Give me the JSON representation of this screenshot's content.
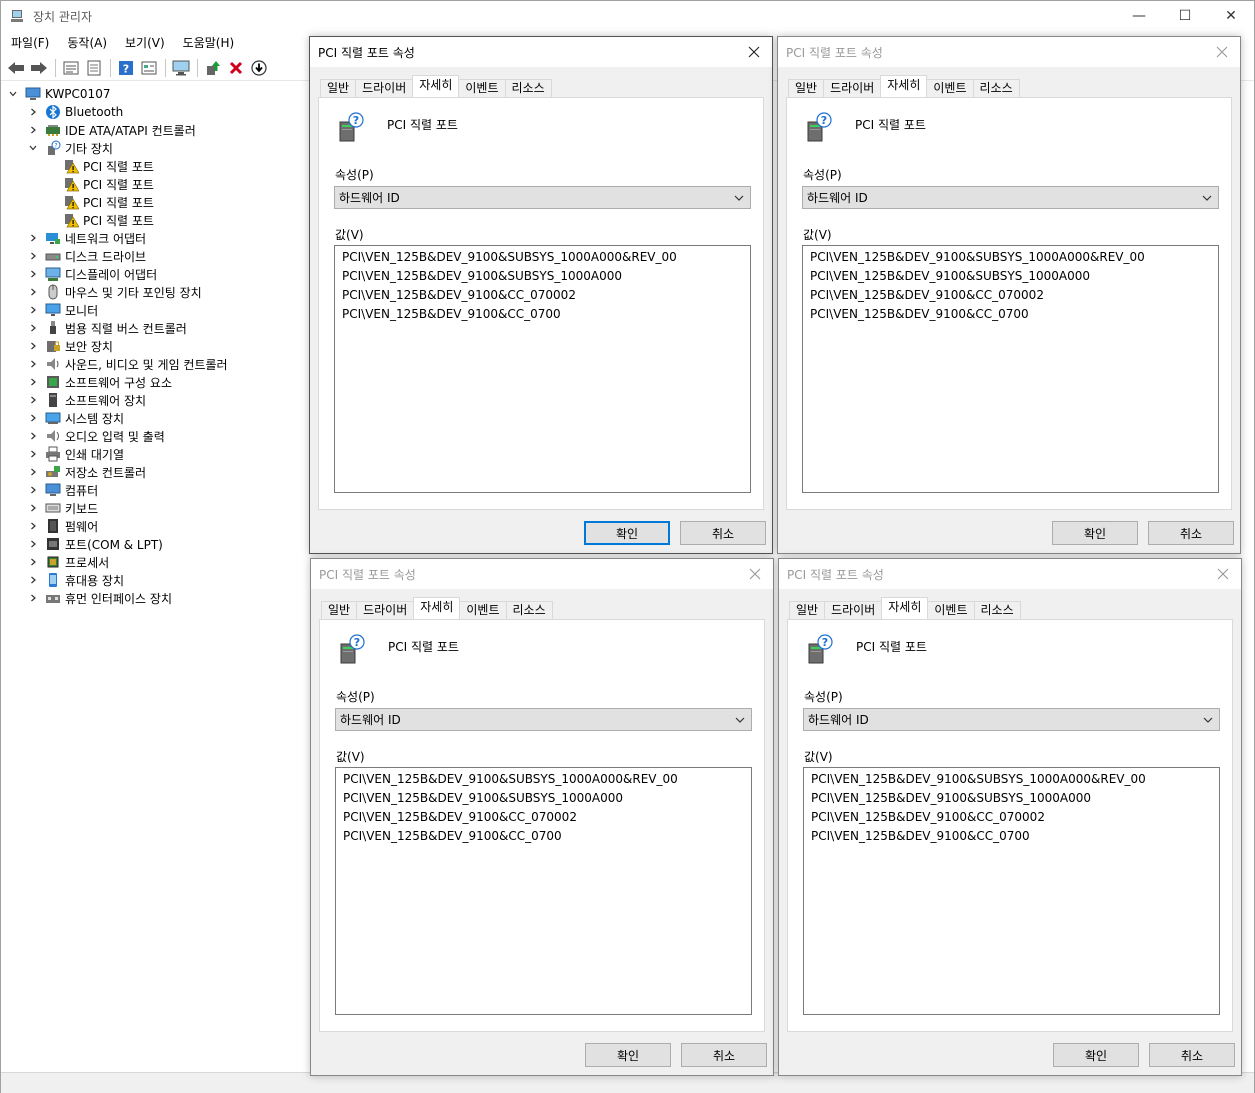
{
  "window": {
    "title": "장치 관리자",
    "controls": {
      "minimize": "—",
      "maximize": "☐",
      "close": "✕"
    }
  },
  "menu": [
    "파일(F)",
    "동작(A)",
    "보기(V)",
    "도움말(H)"
  ],
  "toolbar": [
    "back-arrow-icon",
    "forward-arrow-icon",
    "properties-sheet-icon",
    "list-icon",
    "help-icon",
    "view-icon",
    "monitor-scan-icon",
    "update-driver-icon",
    "uninstall-x-icon",
    "download-circle-icon"
  ],
  "tree": {
    "root": "KWPC0107",
    "items": [
      {
        "label": "Bluetooth",
        "icon": "bluetooth-icon",
        "level": 1,
        "expander": "collapsed"
      },
      {
        "label": "IDE ATA/ATAPI 컨트롤러",
        "icon": "ide-controller-icon",
        "level": 1,
        "expander": "collapsed"
      },
      {
        "label": "기타 장치",
        "icon": "other-device-icon",
        "level": 1,
        "expander": "expanded"
      },
      {
        "label": "PCI 직렬 포트",
        "icon": "warning-device-icon",
        "level": 2,
        "expander": "none"
      },
      {
        "label": "PCI 직렬 포트",
        "icon": "warning-device-icon",
        "level": 2,
        "expander": "none"
      },
      {
        "label": "PCI 직렬 포트",
        "icon": "warning-device-icon",
        "level": 2,
        "expander": "none"
      },
      {
        "label": "PCI 직렬 포트",
        "icon": "warning-device-icon",
        "level": 2,
        "expander": "none"
      },
      {
        "label": "네트워크 어댑터",
        "icon": "network-icon",
        "level": 1,
        "expander": "collapsed"
      },
      {
        "label": "디스크 드라이브",
        "icon": "disk-icon",
        "level": 1,
        "expander": "collapsed"
      },
      {
        "label": "디스플레이 어댑터",
        "icon": "display-adapter-icon",
        "level": 1,
        "expander": "collapsed"
      },
      {
        "label": "마우스 및 기타 포인팅 장치",
        "icon": "mouse-icon",
        "level": 1,
        "expander": "collapsed"
      },
      {
        "label": "모니터",
        "icon": "monitor-icon",
        "level": 1,
        "expander": "collapsed"
      },
      {
        "label": "범용 직렬 버스 컨트롤러",
        "icon": "usb-icon",
        "level": 1,
        "expander": "collapsed"
      },
      {
        "label": "보안 장치",
        "icon": "security-icon",
        "level": 1,
        "expander": "collapsed"
      },
      {
        "label": "사운드, 비디오 및 게임 컨트롤러",
        "icon": "speaker-icon",
        "level": 1,
        "expander": "collapsed"
      },
      {
        "label": "소프트웨어 구성 요소",
        "icon": "software-component-icon",
        "level": 1,
        "expander": "collapsed"
      },
      {
        "label": "소프트웨어 장치",
        "icon": "software-device-icon",
        "level": 1,
        "expander": "collapsed"
      },
      {
        "label": "시스템 장치",
        "icon": "system-device-icon",
        "level": 1,
        "expander": "collapsed"
      },
      {
        "label": "오디오 입력 및 출력",
        "icon": "audio-icon",
        "level": 1,
        "expander": "collapsed"
      },
      {
        "label": "인쇄 대기열",
        "icon": "printer-icon",
        "level": 1,
        "expander": "collapsed"
      },
      {
        "label": "저장소 컨트롤러",
        "icon": "storage-controller-icon",
        "level": 1,
        "expander": "collapsed"
      },
      {
        "label": "컴퓨터",
        "icon": "computer-icon",
        "level": 1,
        "expander": "collapsed"
      },
      {
        "label": "키보드",
        "icon": "keyboard-icon",
        "level": 1,
        "expander": "collapsed"
      },
      {
        "label": "펌웨어",
        "icon": "firmware-icon",
        "level": 1,
        "expander": "collapsed"
      },
      {
        "label": "포트(COM & LPT)",
        "icon": "port-icon",
        "level": 1,
        "expander": "collapsed"
      },
      {
        "label": "프로세서",
        "icon": "processor-icon",
        "level": 1,
        "expander": "collapsed"
      },
      {
        "label": "휴대용 장치",
        "icon": "portable-device-icon",
        "level": 1,
        "expander": "collapsed"
      },
      {
        "label": "휴먼 인터페이스 장치",
        "icon": "hid-icon",
        "level": 1,
        "expander": "collapsed"
      }
    ]
  },
  "dialogs": [
    {
      "title": "PCI 직렬 포트 속성",
      "active": true,
      "tabs": [
        "일반",
        "드라이버",
        "자세히",
        "이벤트",
        "리소스"
      ],
      "selected_tab": "자세히",
      "device_name": "PCI 직렬 포트",
      "property_label": "속성(P)",
      "property_value": "하드웨어 ID",
      "value_label": "값(V)",
      "values": [
        "PCI\\VEN_125B&DEV_9100&SUBSYS_1000A000&REV_00",
        "PCI\\VEN_125B&DEV_9100&SUBSYS_1000A000",
        "PCI\\VEN_125B&DEV_9100&CC_070002",
        "PCI\\VEN_125B&DEV_9100&CC_0700"
      ],
      "ok": "확인",
      "cancel": "취소"
    },
    {
      "title": "PCI 직렬 포트 속성",
      "active": false,
      "tabs": [
        "일반",
        "드라이버",
        "자세히",
        "이벤트",
        "리소스"
      ],
      "selected_tab": "자세히",
      "device_name": "PCI 직렬 포트",
      "property_label": "속성(P)",
      "property_value": "하드웨어 ID",
      "value_label": "값(V)",
      "values": [
        "PCI\\VEN_125B&DEV_9100&SUBSYS_1000A000&REV_00",
        "PCI\\VEN_125B&DEV_9100&SUBSYS_1000A000",
        "PCI\\VEN_125B&DEV_9100&CC_070002",
        "PCI\\VEN_125B&DEV_9100&CC_0700"
      ],
      "ok": "확인",
      "cancel": "취소"
    },
    {
      "title": "PCI 직렬 포트 속성",
      "active": false,
      "tabs": [
        "일반",
        "드라이버",
        "자세히",
        "이벤트",
        "리소스"
      ],
      "selected_tab": "자세히",
      "device_name": "PCI 직렬 포트",
      "property_label": "속성(P)",
      "property_value": "하드웨어 ID",
      "value_label": "값(V)",
      "values": [
        "PCI\\VEN_125B&DEV_9100&SUBSYS_1000A000&REV_00",
        "PCI\\VEN_125B&DEV_9100&SUBSYS_1000A000",
        "PCI\\VEN_125B&DEV_9100&CC_070002",
        "PCI\\VEN_125B&DEV_9100&CC_0700"
      ],
      "ok": "확인",
      "cancel": "취소"
    },
    {
      "title": "PCI 직렬 포트 속성",
      "active": false,
      "tabs": [
        "일반",
        "드라이버",
        "자세히",
        "이벤트",
        "리소스"
      ],
      "selected_tab": "자세히",
      "device_name": "PCI 직렬 포트",
      "property_label": "속성(P)",
      "property_value": "하드웨어 ID",
      "value_label": "값(V)",
      "values": [
        "PCI\\VEN_125B&DEV_9100&SUBSYS_1000A000&REV_00",
        "PCI\\VEN_125B&DEV_9100&SUBSYS_1000A000",
        "PCI\\VEN_125B&DEV_9100&CC_070002",
        "PCI\\VEN_125B&DEV_9100&CC_0700"
      ],
      "ok": "확인",
      "cancel": "취소"
    }
  ],
  "colors": {
    "accent": "#0078d7",
    "warning": "#f0c000",
    "dialog_bg": "#f0f0f0",
    "button_bg": "#e1e1e1"
  }
}
